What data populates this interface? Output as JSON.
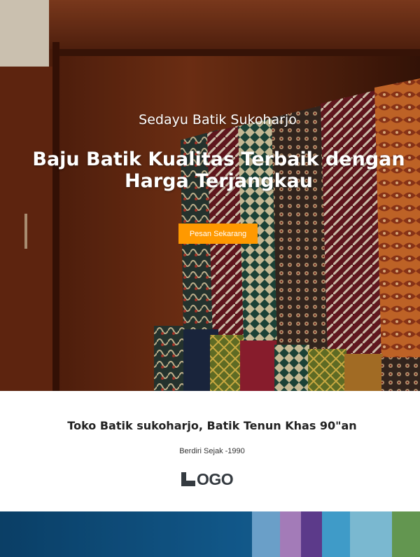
{
  "hero": {
    "subtitle": "Sedayu Batik Sukoharjo",
    "title": "Baju Batik Kualitas Terbaik dengan Harga Terjangkau",
    "cta_label": "Pesan Sekarang",
    "cta_color": "#ff9900"
  },
  "about": {
    "title": "Toko Batik sukoharjo, Batik Tenun Khas 90\"an",
    "since": "Berdiri Sejak -1990",
    "logo_text": "OGO"
  }
}
